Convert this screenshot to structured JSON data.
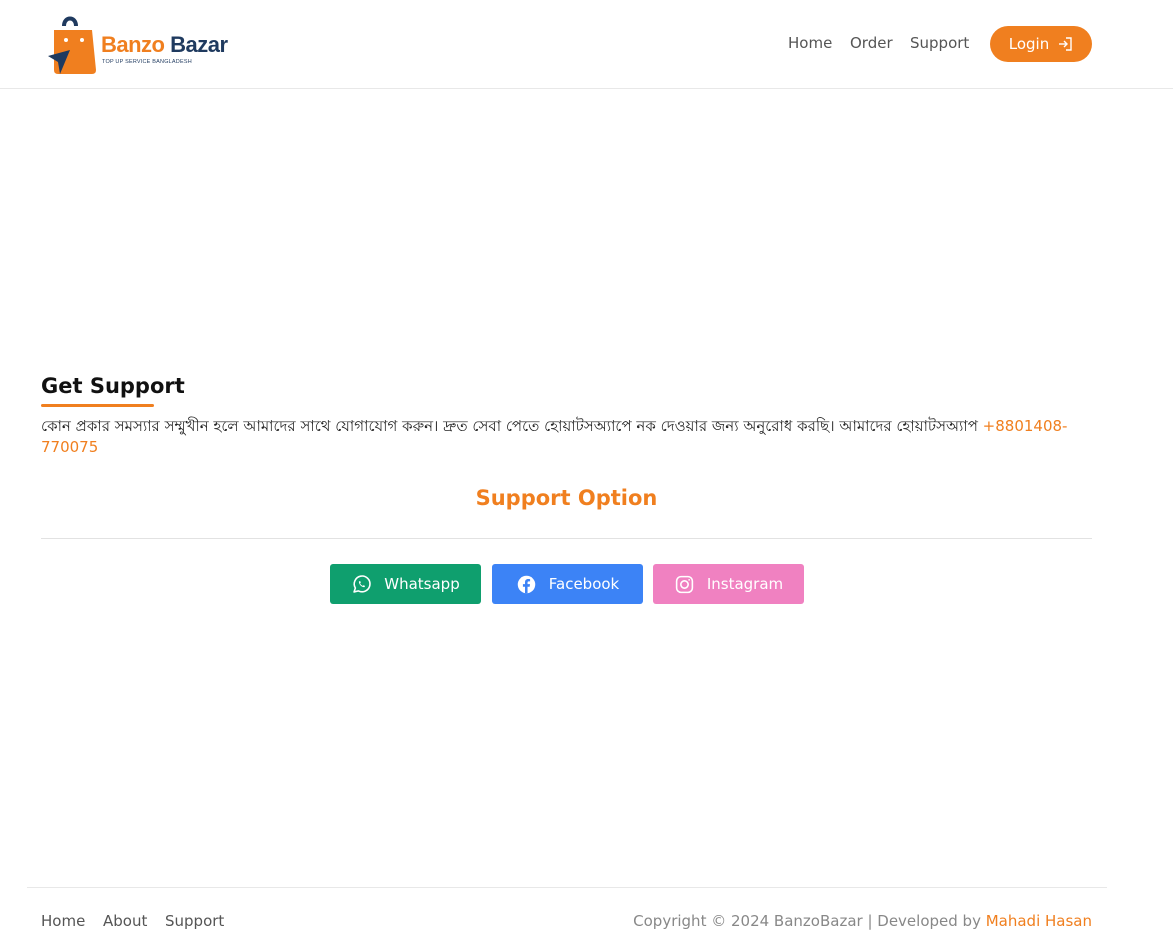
{
  "brand": {
    "name_part1": "Banzo",
    "name_part2": "Bazar",
    "tagline": "TOP UP SERVICE BANGLADESH"
  },
  "header": {
    "nav": [
      "Home",
      "Order",
      "Support"
    ],
    "login_label": "Login"
  },
  "support": {
    "title": "Get Support",
    "description": "কোন প্রকার সমস্যার সম্মুখীন হলে আমাদের সাথে যোগাযোগ করুন। দ্রুত সেবা পেতে হোয়াটসঅ্যাপে নক দেওয়ার জন্য অনুরোধ করছি। আমাদের হোয়াটসঅ্যাপ ",
    "phone": "+8801408-770075",
    "options_heading": "Support Option",
    "buttons": {
      "whatsapp": "Whatsapp",
      "facebook": "Facebook",
      "instagram": "Instagram"
    }
  },
  "footer": {
    "nav": [
      "Home",
      "About",
      "Support"
    ],
    "copyright": "Copyright © 2024 BanzoBazar | Developed by ",
    "developer": "Mahadi Hasan"
  },
  "colors": {
    "accent": "#f07f1f",
    "navy": "#1f3a5f",
    "whatsapp": "#0f9f6e",
    "facebook": "#3c83f6",
    "instagram": "#f081c1"
  },
  "icons": {
    "login": "login-icon",
    "whatsapp": "whatsapp-icon",
    "facebook": "facebook-icon",
    "instagram": "instagram-icon",
    "logo": "shopping-bag-logo-icon"
  }
}
